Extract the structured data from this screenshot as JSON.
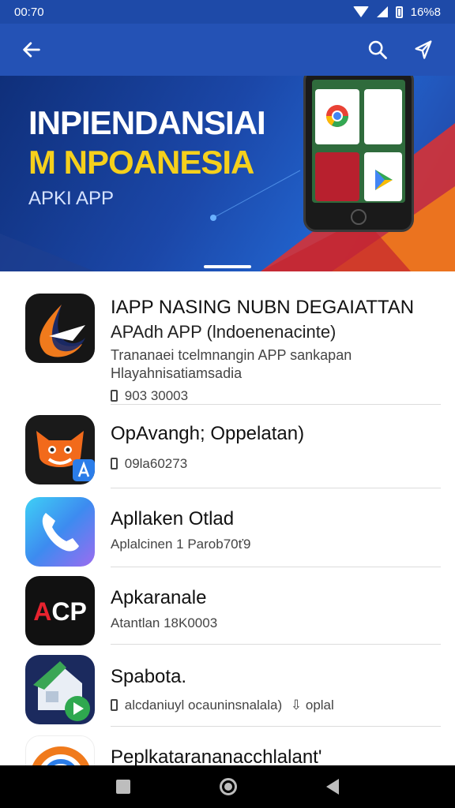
{
  "status_bar": {
    "time": "00:70",
    "battery_text": "16%8"
  },
  "app_bar": {
    "back_icon": "arrow-left-icon",
    "search_icon": "search-icon",
    "share_icon": "share-icon"
  },
  "banner": {
    "line1": "INPIENDANSIAI",
    "line2": "M NPOANESIA",
    "line3": "APKI APP"
  },
  "apps": [
    {
      "title": "IAPP NASING NUBN DEGAIATTAN",
      "subtitle": "APAdh APP (lndoenenacinte)",
      "desc1": "Trananaei tcelmnangin APP sankapan",
      "desc2": "Hlayahnisatiamsadia",
      "meta": "903 30003"
    },
    {
      "title": "OpAvangh; Oppelatan)",
      "meta": "09la60273"
    },
    {
      "title": "Apllaken Otlad",
      "meta": "Aplalcinen 1 Parob70ť9"
    },
    {
      "title": "Apkaranale",
      "meta": "Atantlan 18K0003"
    },
    {
      "title": "Spabota.",
      "meta": "alcdaniuyl ocauninsnalala)",
      "meta_extra": "oplal"
    },
    {
      "title": "Peplkatarananacchlalant'"
    }
  ],
  "colors": {
    "primary": "#2452b5",
    "accent": "#f5d01c"
  }
}
